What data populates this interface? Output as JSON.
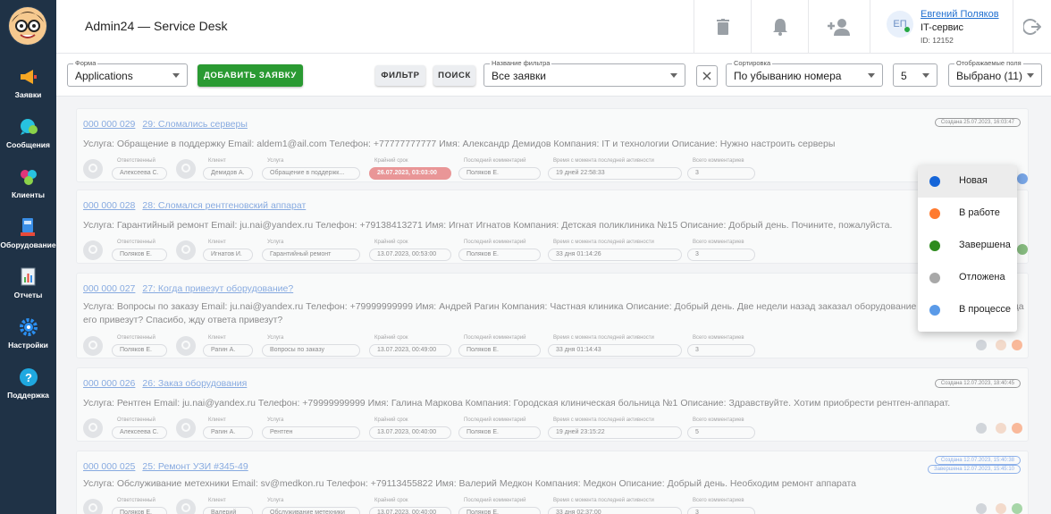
{
  "app": {
    "title": "Admin24 — Service Desk"
  },
  "sidebar": {
    "items": [
      {
        "label": "Заявки",
        "icon": "megaphone-icon",
        "color": "#f5a623"
      },
      {
        "label": "Сообщения",
        "icon": "chat-icon",
        "color": "#27c2e0"
      },
      {
        "label": "Клиенты",
        "icon": "users-icon",
        "color": "#e0347a"
      },
      {
        "label": "Оборудование",
        "icon": "equipment-icon",
        "color": "#3a8ee6"
      },
      {
        "label": "Отчеты",
        "icon": "report-icon",
        "color": "#4caf50"
      },
      {
        "label": "Настройки",
        "icon": "gear-icon",
        "color": "#2a8ef0"
      },
      {
        "label": "Поддержка",
        "icon": "help-icon",
        "color": "#1fa8e0"
      }
    ]
  },
  "header": {
    "user": {
      "initials": "ЕП",
      "name": "Евгений Поляков",
      "dept": "IT-сервис",
      "id": "ID: 12152"
    }
  },
  "toolbar": {
    "form": {
      "legend": "Форма",
      "value": "Applications"
    },
    "add_button": "ДОБАВИТЬ ЗАЯВКУ",
    "filter_button": "ФИЛЬТР",
    "search_button": "ПОИСК",
    "filter_name": {
      "legend": "Название фильтра",
      "value": "Все заявки"
    },
    "sort": {
      "legend": "Сортировка",
      "value": "По убыванию номера"
    },
    "page_size": {
      "value": "5"
    },
    "fields": {
      "legend": "Отображаемые поля",
      "value": "Выбрано (11)"
    }
  },
  "meta_labels": {
    "responsible": "Ответственный",
    "client": "Клиент",
    "service": "Услуга",
    "deadline": "Крайний срок",
    "last_comment": "Последний комментарий",
    "last_activity": "Время с момента последней активности",
    "total_comments": "Всего комментариев"
  },
  "tickets": [
    {
      "number": "000 000 029",
      "title": "29: Сломались серверы",
      "desc": "Услуга: Обращение в поддержку Email: aldem1@ail.com Телефон: +77777777777 Имя: Александр Демидов Компания: IT и технологии Описание: Нужно настроить серверы",
      "responsible": "Алексеева С.",
      "client": "Демидов А.",
      "service": "Обращение в поддержк...",
      "deadline": "26.07.2023, 03:03:00",
      "last_comment": "Поляков Е.",
      "last_activity": "19 дней 22:58:33",
      "total_comments": "3",
      "created": [
        "Создана 25.07.2023, 16:03:47"
      ],
      "status_color": "#1565d8"
    },
    {
      "number": "000 000 028",
      "title": "28: Сломался рентгеновский аппарат",
      "desc": "Услуга: Гарантийный ремонт Email: ju.nai@yandex.ru Телефон: +79138413271 Имя: Игнат Игнатов Компания: Детская поликлиника №15 Описание: Добрый день. Почините, пожалуйста.",
      "responsible": "Поляков Е.",
      "client": "Игнатов И.",
      "service": "Гарантийный ремонт",
      "deadline": "13.07.2023, 00:53:00",
      "last_comment": "Поляков Е.",
      "last_activity": "33 дня 01:14:26",
      "total_comments": "3",
      "created": [],
      "status_color": "#2e8b1e"
    },
    {
      "number": "000 000 027",
      "title": "27: Когда привезут оборудование?",
      "desc": "Услуга: Вопросы по заказу Email: ju.nai@yandex.ru Телефон: +79999999999 Имя: Андрей Рагин Компания: Частная клиника Описание: Добрый день. Две недели назад заказал оборудование для лаборатории. Когда его привезут? Спасибо, жду ответа привезут?",
      "responsible": "Поляков Е.",
      "client": "Рагин А.",
      "service": "Вопросы по заказу",
      "deadline": "13.07.2023, 00:49:00",
      "last_comment": "Поляков Е.",
      "last_activity": "33 дня 01:14:43",
      "total_comments": "3",
      "created": [],
      "status_color": "#ff8a50"
    },
    {
      "number": "000 000 026",
      "title": "26: Заказ оборудования",
      "desc": "Услуга: Рентген Email: ju.nai@yandex.ru Телефон: +79999999999 Имя: Галина Маркова Компания: Городская клиническая больница №1 Описание: Здравствуйте. Хотим приобрести рентген-аппарат.",
      "responsible": "Алексеева С.",
      "client": "Рагин А.",
      "service": "Рентген",
      "deadline": "13.07.2023, 00:40:00",
      "last_comment": "Поляков Е.",
      "last_activity": "19 дней 23:15:22",
      "total_comments": "5",
      "created": [
        "Создана 12.07.2023, 18:40:45"
      ],
      "status_color": "#ff8a50"
    },
    {
      "number": "000 000 025",
      "title": "25: Ремонт УЗИ #345-49",
      "desc": "Услуга: Обслуживание метехники Email: sv@medkon.ru Телефон: +79113455822 Имя: Валерий Медкон Компания: Медкон Описание: Добрый день. Необходим ремонт аппарата",
      "responsible": "Поляков Е.",
      "client": "Валерий",
      "service": "Обслуживание метехники",
      "deadline": "13.07.2023, 00:40:00",
      "last_comment": "Поляков Е.",
      "last_activity": "33 дня 02:37:00",
      "total_comments": "3",
      "created": [
        "Создана 12.07.2023, 15:40:38",
        "Завершена 12.07.2023, 15:45:10"
      ],
      "status_color": "#6abf69"
    }
  ],
  "status_menu": [
    {
      "label": "Новая",
      "color": "#1565d8"
    },
    {
      "label": "В работе",
      "color": "#ff7a2f"
    },
    {
      "label": "Завершена",
      "color": "#2e8b1e"
    },
    {
      "label": "Отложена",
      "color": "#a8a8a8"
    },
    {
      "label": "В процессе",
      "color": "#5a9ae8"
    }
  ]
}
